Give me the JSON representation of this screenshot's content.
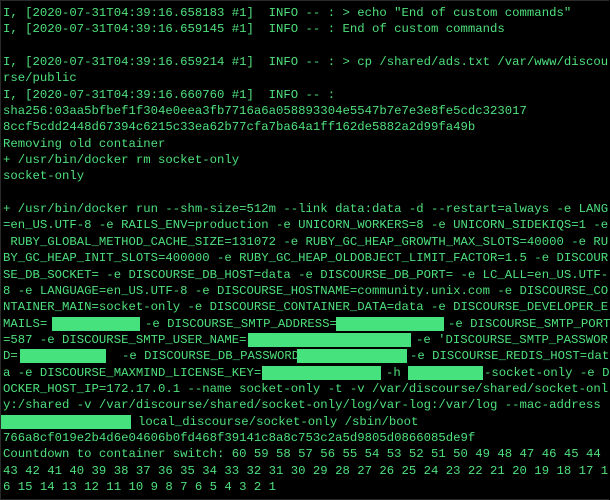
{
  "terminal": {
    "text_color": "#4ee07c",
    "background": "#000000",
    "redaction_color": "#45e27e",
    "lines": [
      "I, [2020-07-31T04:39:16.658183 #1]  INFO -- : > echo \"End of custom commands\"",
      "I, [2020-07-31T04:39:16.659145 #1]  INFO -- : End of custom commands",
      "",
      "I, [2020-07-31T04:39:16.659214 #1]  INFO -- : > cp /shared/ads.txt /var/www/discou",
      "rse/public",
      "I, [2020-07-31T04:39:16.660760 #1]  INFO -- :",
      "sha256:03aa5bfbef1f304e0eea3fb7716a6a058893304e5547b7e7e3e8fe5cdc323017",
      "8ccf5cdd2448d67394c6215c33ea62b77cfa7ba64a1ff162de5882a2d99fa49b",
      "Removing old container",
      "+ /usr/bin/docker rm socket-only",
      "socket-only",
      "",
      "+ /usr/bin/docker run --shm-size=512m --link data:data -d --restart=always -e LANG",
      "=en_US.UTF-8 -e RAILS_ENV=production -e UNICORN_WORKERS=8 -e UNICORN_SIDEKIQS=1 -e",
      " RUBY_GLOBAL_METHOD_CACHE_SIZE=131072 -e RUBY_GC_HEAP_GROWTH_MAX_SLOTS=40000 -e RU",
      "BY_GC_HEAP_INIT_SLOTS=400000 -e RUBY_GC_HEAP_OLDOBJECT_LIMIT_FACTOR=1.5 -e DISCOUR",
      "SE_DB_SOCKET= -e DISCOURSE_DB_HOST=data -e DISCOURSE_DB_PORT= -e LC_ALL=en_US.UTF-",
      "8 -e LANGUAGE=en_US.UTF-8 -e DISCOURSE_HOSTNAME=community.unix.com -e DISCOURSE_CO",
      "NTAINER_MAIN=socket-only -e DISCOURSE_CONTAINER_DATA=data -e DISCOURSE_DEVELOPER_E",
      [
        "MAILS=",
        "-e DISCOURSE_SMTP_ADDRESS=",
        "-e DISCOURSE_SMTP_PORT"
      ],
      [
        "=587 -e DISCOURSE_SMTP_USER_NAME=",
        "-e 'DISCOURSE_SMTP_PASSWOR"
      ],
      [
        "D=",
        "-e DISCOURSE_DB_PASSWORD=",
        "-e DISCOURSE_REDIS_HOST=dat"
      ],
      [
        "a -e DISCOURSE_MAXMIND_LICENSE_KEY=",
        "-h",
        "-socket-only -e D"
      ],
      "OCKER_HOST_IP=172.17.0.1 --name socket-only -t -v /var/discourse/shared/socket-onl",
      "y:/shared -v /var/discourse/shared/socket-only/log/var-log:/var/log --mac-address",
      [
        "local_discourse/socket-only /sbin/boot"
      ],
      "766a8cf019e2b4d6e04606b0fd468f39141c8a8c753c2a5d9805d0866085de9f",
      "Countdown to container switch: 60 59 58 57 56 55 54 53 52 51 50 49 48 47 46 45 44",
      "43 42 41 40 39 38 37 36 35 34 33 32 31 30 29 28 27 26 25 24 23 22 21 20 19 18 17 1",
      "6 15 14 13 12 11 10 9 8 7 6 5 4 3 2 1"
    ]
  }
}
